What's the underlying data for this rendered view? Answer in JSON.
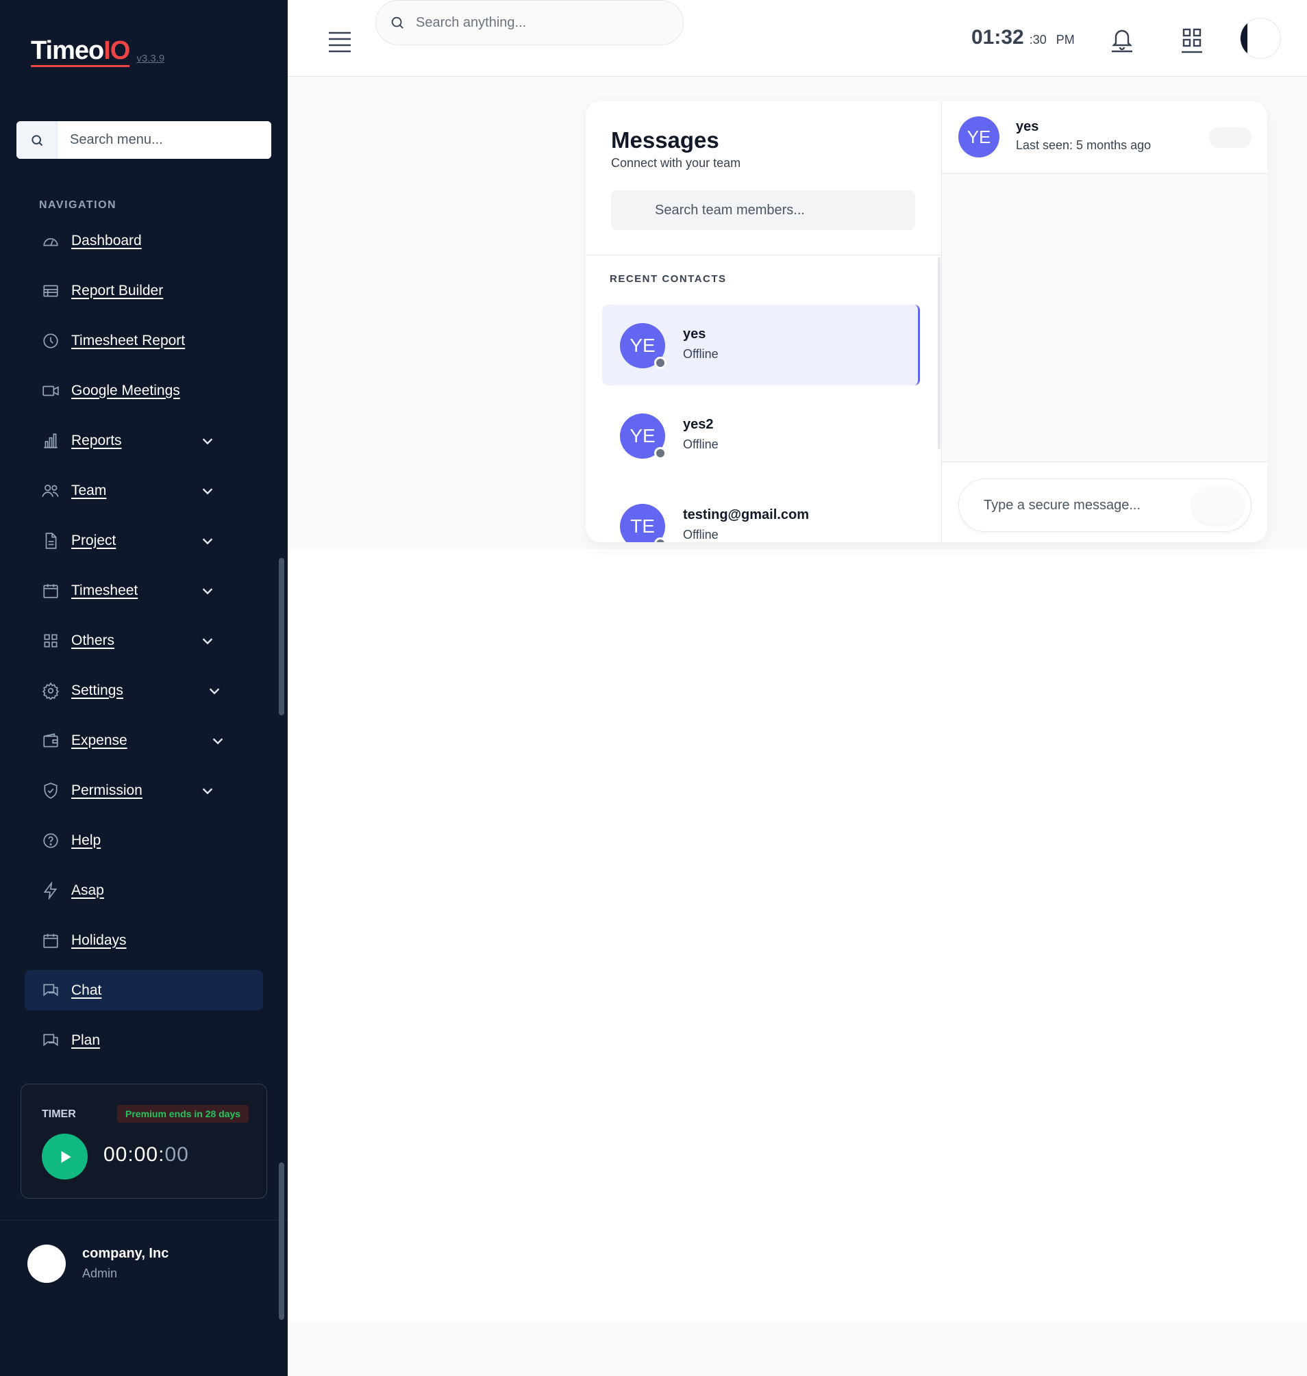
{
  "app": {
    "logo_prefix": "Time",
    "logo_accent": "IO",
    "logo_middle": "o",
    "version": "v3.3.9"
  },
  "sidebar": {
    "search_placeholder": "Search menu...",
    "nav_label": "NAVIGATION",
    "items": [
      {
        "label": "Dashboard",
        "icon": "gauge-icon",
        "has_children": false
      },
      {
        "label": "Report Builder",
        "icon": "table-icon",
        "has_children": false
      },
      {
        "label": "Timesheet Report",
        "icon": "clock-circle-icon",
        "has_children": false
      },
      {
        "label": "Google Meetings",
        "icon": "video-camera-icon",
        "has_children": false
      },
      {
        "label": "Reports",
        "icon": "bar-chart-icon",
        "has_children": true
      },
      {
        "label": "Team",
        "icon": "users-icon",
        "has_children": true
      },
      {
        "label": "Project",
        "icon": "document-icon",
        "has_children": true
      },
      {
        "label": "Timesheet",
        "icon": "calendar-icon",
        "has_children": true
      },
      {
        "label": "Others",
        "icon": "grid-icon",
        "has_children": true
      },
      {
        "label": "Settings",
        "icon": "gear-icon",
        "has_children": true
      },
      {
        "label": "Expense",
        "icon": "wallet-icon",
        "has_children": true
      },
      {
        "label": "Permission",
        "icon": "shield-check-icon",
        "has_children": true
      },
      {
        "label": "Help",
        "icon": "question-circle-icon",
        "has_children": false
      },
      {
        "label": "Asap",
        "icon": "lightning-icon",
        "has_children": false
      },
      {
        "label": "Holidays",
        "icon": "calendar-icon",
        "has_children": false
      },
      {
        "label": "Chat",
        "icon": "chat-icon",
        "has_children": false,
        "active": true
      },
      {
        "label": "Plan",
        "icon": "chat-icon",
        "has_children": false
      }
    ],
    "timer": {
      "label": "TIMER",
      "premium": "Premium ends in 28 days",
      "hh": "00",
      "mm": "00",
      "ss": "00"
    },
    "company": {
      "name": "company, Inc",
      "role": "Admin"
    }
  },
  "header": {
    "search_placeholder": "Search anything...",
    "clock_hm": "01:32",
    "clock_s": ":30",
    "clock_ampm": "PM"
  },
  "messages": {
    "title": "Messages",
    "subtitle": "Connect with your team",
    "search_placeholder": "Search team members...",
    "recent_label": "RECENT CONTACTS",
    "contacts": [
      {
        "initials": "YE",
        "name": "yes",
        "status": "Offline",
        "active": true
      },
      {
        "initials": "YE",
        "name": "yes2",
        "status": "Offline",
        "active": false
      },
      {
        "initials": "TE",
        "name": "testing@gmail.com",
        "status": "Offline",
        "active": false
      }
    ],
    "chat": {
      "initials": "YE",
      "name": "yes",
      "last_seen": "Last seen: 5 months ago",
      "input_placeholder": "Type a secure message..."
    }
  },
  "colors": {
    "sidebar_bg": "#0f172a",
    "accent": "#6366f1",
    "logo_red": "#ef4444",
    "timer_green": "#10b981"
  }
}
